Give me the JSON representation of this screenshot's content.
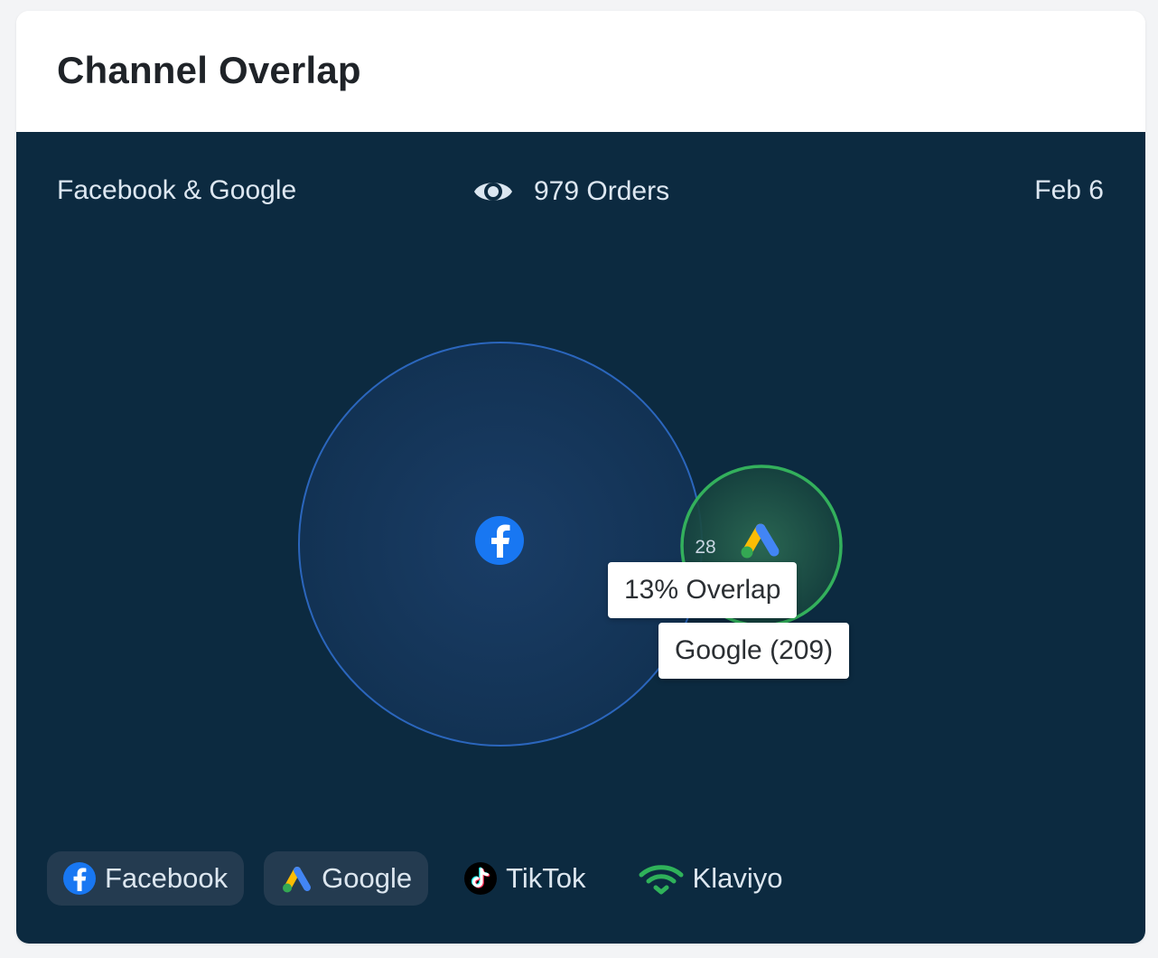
{
  "card": {
    "title": "Channel Overlap"
  },
  "summary": {
    "pair_label": "Facebook & Google",
    "orders_label": "979 Orders",
    "date_label": "Feb 6"
  },
  "venn": {
    "primary": {
      "name": "Facebook",
      "icon": "facebook-icon",
      "color": "#1877f2"
    },
    "secondary": {
      "name": "Google",
      "icon": "google-ads-icon",
      "color": "#2fb25a",
      "count_label": "28"
    },
    "overlap_label": "13% Overlap",
    "hover_label": "Google (209)"
  },
  "legend": [
    {
      "label": "Facebook",
      "icon": "facebook-icon",
      "active": true
    },
    {
      "label": "Google",
      "icon": "google-ads-icon",
      "active": true
    },
    {
      "label": "TikTok",
      "icon": "tiktok-icon",
      "active": false
    },
    {
      "label": "Klaviyo",
      "icon": "klaviyo-icon",
      "active": false
    }
  ],
  "colors": {
    "panel_bg": "#0c2a40",
    "facebook_blue": "#1877f2",
    "google_green": "#2fb25a"
  }
}
